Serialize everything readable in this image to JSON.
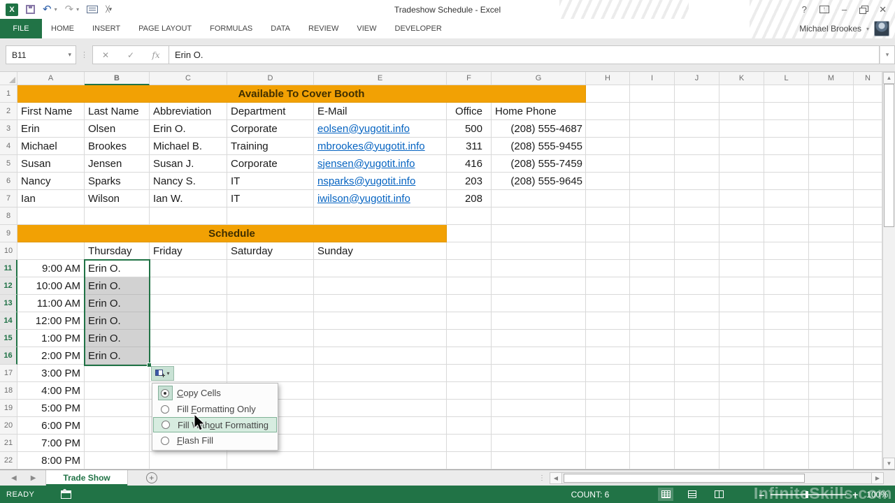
{
  "titlebar": {
    "title": "Tradeshow Schedule - Excel",
    "user_name": "Michael Brookes"
  },
  "ribbon": {
    "tabs": [
      "FILE",
      "HOME",
      "INSERT",
      "PAGE LAYOUT",
      "FORMULAS",
      "DATA",
      "REVIEW",
      "VIEW",
      "DEVELOPER"
    ]
  },
  "formula_bar": {
    "name_box": "B11",
    "fx_label": "fx",
    "value": "Erin O."
  },
  "grid": {
    "col_headers": [
      "A",
      "B",
      "C",
      "D",
      "E",
      "F",
      "G",
      "H",
      "I",
      "J",
      "K",
      "L",
      "M",
      "N"
    ],
    "row_numbers": [
      "1",
      "2",
      "3",
      "4",
      "5",
      "6",
      "7",
      "8",
      "9",
      "10",
      "11",
      "12",
      "13",
      "14",
      "15",
      "16",
      "17",
      "18",
      "19",
      "20",
      "21",
      "22"
    ],
    "banner_available": "Available To Cover Booth",
    "banner_schedule": "Schedule",
    "contact_headers": [
      "First Name",
      "Last Name",
      "Abbreviation",
      "Department",
      "E-Mail",
      "Office",
      "Home Phone"
    ],
    "contacts": [
      {
        "first": "Erin",
        "last": "Olsen",
        "abbr": "Erin O.",
        "dept": "Corporate",
        "email": "eolsen@yugotit.info",
        "office": "500",
        "phone": "(208) 555-4687"
      },
      {
        "first": "Michael",
        "last": "Brookes",
        "abbr": "Michael B.",
        "dept": "Training",
        "email": "mbrookes@yugotit.info",
        "office": "311",
        "phone": "(208) 555-9455"
      },
      {
        "first": "Susan",
        "last": "Jensen",
        "abbr": "Susan J.",
        "dept": "Corporate",
        "email": "sjensen@yugotit.info",
        "office": "416",
        "phone": "(208) 555-7459"
      },
      {
        "first": "Nancy",
        "last": "Sparks",
        "abbr": "Nancy S.",
        "dept": "IT",
        "email": "nsparks@yugotit.info",
        "office": "203",
        "phone": "(208) 555-9645"
      },
      {
        "first": "Ian",
        "last": "Wilson",
        "abbr": "Ian W.",
        "dept": "IT",
        "email": "iwilson@yugotit.info",
        "office": "208",
        "phone": ""
      }
    ],
    "day_headers": [
      "Thursday",
      "Friday",
      "Saturday",
      "Sunday"
    ],
    "schedule": [
      {
        "time": "9:00 AM",
        "who": "Erin O."
      },
      {
        "time": "10:00 AM",
        "who": "Erin O."
      },
      {
        "time": "11:00 AM",
        "who": "Erin O."
      },
      {
        "time": "12:00 PM",
        "who": "Erin O."
      },
      {
        "time": "1:00 PM",
        "who": "Erin O."
      },
      {
        "time": "2:00 PM",
        "who": "Erin O."
      },
      {
        "time": "3:00 PM",
        "who": ""
      },
      {
        "time": "4:00 PM",
        "who": ""
      },
      {
        "time": "5:00 PM",
        "who": ""
      },
      {
        "time": "6:00 PM",
        "who": ""
      },
      {
        "time": "7:00 PM",
        "who": ""
      },
      {
        "time": "8:00 PM",
        "who": ""
      }
    ]
  },
  "fill_menu": {
    "items": [
      {
        "pre": "",
        "key": "C",
        "post": "opy Cells"
      },
      {
        "pre": "Fill ",
        "key": "F",
        "post": "ormatting Only"
      },
      {
        "pre": "Fill With",
        "key": "o",
        "post": "ut Formatting"
      },
      {
        "pre": "",
        "key": "F",
        "post": "lash Fill"
      }
    ]
  },
  "sheet_tabs": {
    "active_tab": "Trade Show"
  },
  "status_bar": {
    "mode": "READY",
    "count": "COUNT: 6",
    "zoom": "100%"
  },
  "watermark": "InfiniteSkills.com",
  "colors": {
    "excel_green": "#217346",
    "banner_orange": "#F2A104",
    "link_blue": "#0563C1",
    "selection_gray": "#D2D2D2",
    "menu_highlight": "#D7ECE0"
  }
}
